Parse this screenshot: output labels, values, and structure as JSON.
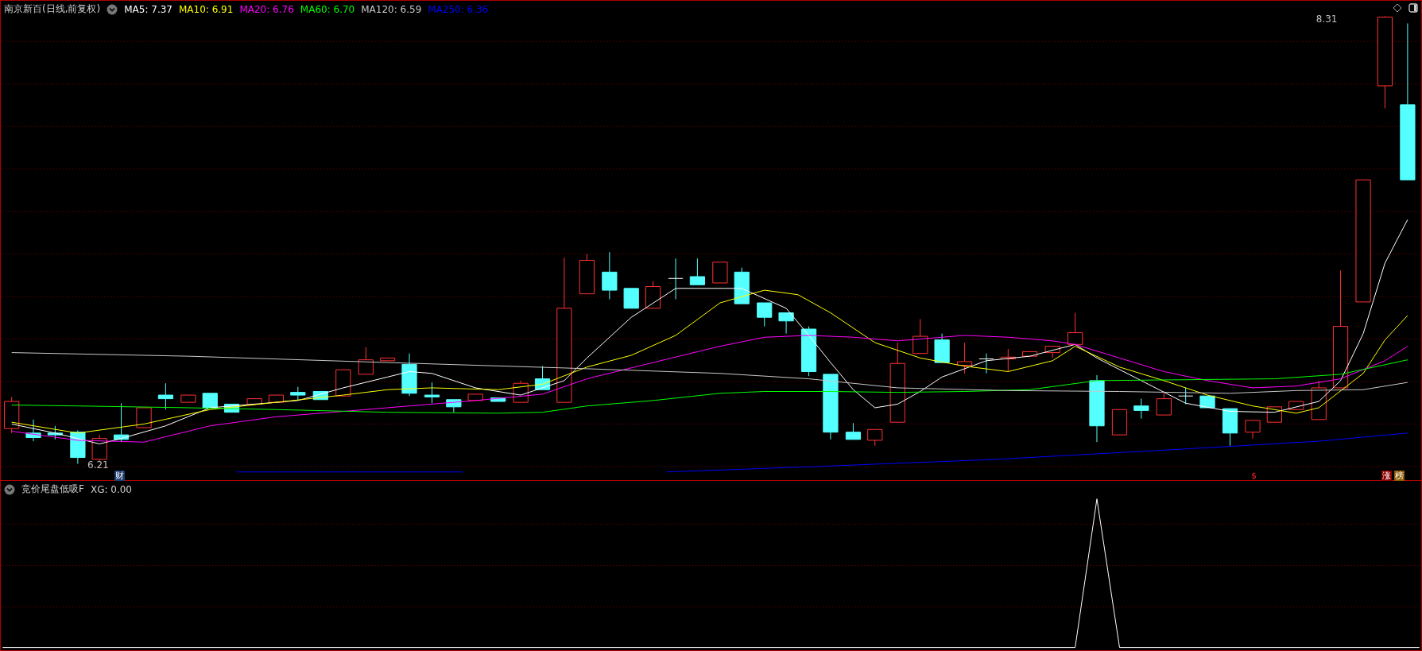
{
  "main_panel": {
    "title": "南京新百(日线,前复权)",
    "ma_labels": [
      {
        "label": "MA5: 7.37",
        "color": "#ffffff"
      },
      {
        "label": "MA10: 6.91",
        "color": "#ffff00"
      },
      {
        "label": "MA20: 6.76",
        "color": "#ff00ff"
      },
      {
        "label": "MA60: 6.70",
        "color": "#00ff00"
      },
      {
        "label": "MA120: 6.59",
        "color": "#c8c8c8"
      },
      {
        "label": "MA250: 6.36",
        "color": "#0000ff"
      }
    ],
    "price_marks": [
      {
        "kind": "high",
        "text": "8.31"
      },
      {
        "kind": "low",
        "text": "6.21"
      }
    ],
    "event_badges": [
      {
        "kind": "finance",
        "text": "财"
      },
      {
        "kind": "dollar",
        "text": "$"
      },
      {
        "kind": "rise",
        "text": "涨"
      },
      {
        "kind": "rank",
        "text": "榜"
      }
    ]
  },
  "indicator_panel": {
    "title": "竞价尾盘低吸F",
    "readout": "XG: 0.00"
  }
}
